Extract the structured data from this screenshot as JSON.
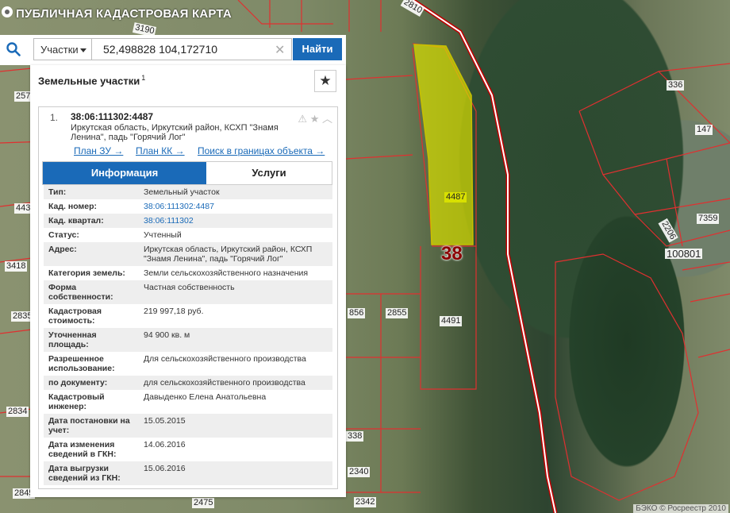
{
  "app": {
    "title": "ПУБЛИЧНАЯ КАДАСТРОВАЯ КАРТА"
  },
  "search": {
    "type_value": "Участки",
    "query": "52,498828 104,172710",
    "find_label": "Найти"
  },
  "panel": {
    "title": "Земельные участки",
    "count": "1",
    "item": {
      "index": "1.",
      "cad_number": "38:06:111302:4487",
      "address": "Иркутская область, Иркутский район, КСХП \"Знамя Ленина\", падь \"Горячий Лог\"",
      "links": {
        "plan_zu": "План ЗУ →",
        "plan_kk": "План КК →",
        "search_in_bounds": "Поиск в границах объекта →"
      },
      "tabs": {
        "info": "Информация",
        "services": "Услуги"
      },
      "props": [
        {
          "k": "Тип:",
          "v": "Земельный участок"
        },
        {
          "k": "Кад. номер:",
          "v": "38:06:111302:4487"
        },
        {
          "k": "Кад. квартал:",
          "v": "38:06:111302"
        },
        {
          "k": "Статус:",
          "v": "Учтенный"
        },
        {
          "k": "Адрес:",
          "v": "Иркутская область, Иркутский район, КСХП \"Знамя Ленина\", падь \"Горячий Лог\""
        },
        {
          "k": "Категория земель:",
          "v": "Земли сельскохозяйственного назначения"
        },
        {
          "k": "Форма собственности:",
          "v": "Частная собственность"
        },
        {
          "k": "Кадастровая стоимость:",
          "v": "219 997,18 руб."
        },
        {
          "k": "Уточненная площадь:",
          "v": "94 900 кв. м"
        },
        {
          "k": "Разрешенное использование:",
          "v": "Для сельскохозяйственного производства"
        },
        {
          "k": "по документу:",
          "v": "для сельскохозяйственного производства"
        },
        {
          "k": "Кадастровый инженер:",
          "v": "Давыденко Елена Анатольевна"
        },
        {
          "k": "Дата постановки на учет:",
          "v": "15.05.2015"
        },
        {
          "k": "Дата изменения сведений в ГКН:",
          "v": "14.06.2016"
        },
        {
          "k": "Дата выгрузки сведений из ГКН:",
          "v": "15.06.2016"
        }
      ]
    }
  },
  "map": {
    "region_badge": "38",
    "parcel_labels": [
      "4487",
      "4491",
      "2855",
      "856",
      "336",
      "147",
      "7359",
      "2206",
      "100801",
      "3418",
      "2835",
      "2834",
      "443",
      "257",
      "2475",
      "2342",
      "2340",
      "338",
      "2845",
      "2810",
      "3190"
    ],
    "copyright": "БЭКО © Росреестр 2010"
  }
}
